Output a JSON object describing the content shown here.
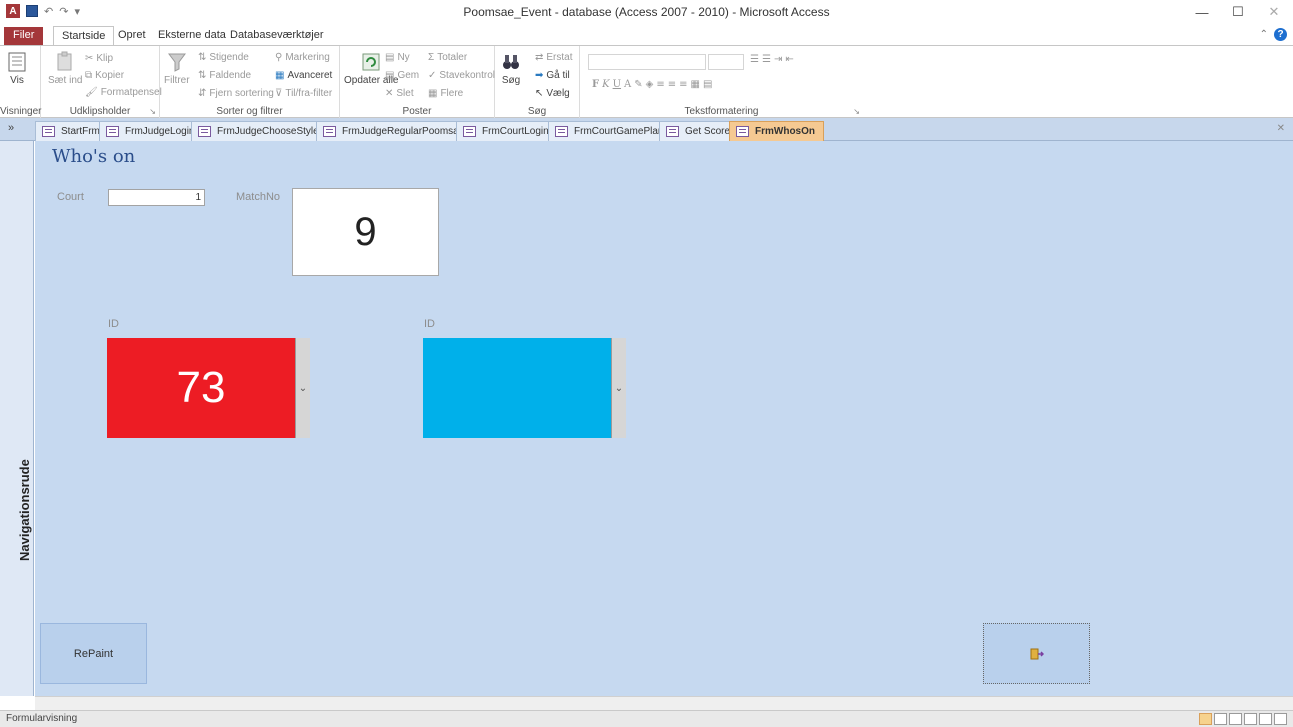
{
  "window": {
    "title": "Poomsae_Event - database (Access 2007 - 2010) - Microsoft Access",
    "app_icon_letter": "A",
    "minimize": "—",
    "maximize": "☐",
    "close": "✕",
    "help": "?",
    "collapse": "⌃"
  },
  "ribbon_tabs": [
    "Filer",
    "Startside",
    "Opret",
    "Eksterne data",
    "Databaseværktøjer"
  ],
  "ribbon": {
    "visninger": {
      "vis": "Vis",
      "name": "Visninger"
    },
    "clipboard": {
      "paste": "Sæt ind",
      "cut": "Klip",
      "copy": "Kopier",
      "format_painter": "Formatpensel",
      "name": "Udklipsholder"
    },
    "sort": {
      "filter": "Filtrer",
      "asc": "Stigende",
      "desc": "Faldende",
      "remove": "Fjern sortering",
      "selection": "Markering",
      "advanced": "Avanceret",
      "toggle": "Til/fra-filter",
      "name": "Sorter og filtrer"
    },
    "records": {
      "refresh": "Opdater alle",
      "new": "Ny",
      "save": "Gem",
      "delete": "Slet",
      "totals": "Totaler",
      "spelling": "Stavekontrol",
      "more": "Flere",
      "name": "Poster"
    },
    "find": {
      "find": "Søg",
      "replace": "Erstat",
      "goto": "Gå til",
      "select": "Vælg",
      "name": "Søg"
    },
    "text": {
      "bold": "F",
      "italic": "K",
      "underline": "U",
      "name": "Tekstformatering"
    }
  },
  "doc_tabs": [
    "StartFrm",
    "FrmJudgeLogin",
    "FrmJudgeChooseStyle",
    "FrmJudgeRegularPoomsae",
    "FrmCourtLogin",
    "FrmCourtGamePlan",
    "Get Score",
    "FrmWhosOn"
  ],
  "nav_pane_label": "Navigationsrude",
  "form": {
    "title": "Who's on",
    "court_label": "Court",
    "court_value": "1",
    "match_label": "MatchNo",
    "match_value": "9",
    "red": {
      "label": "ID",
      "value": "73",
      "color": "#ed1c24"
    },
    "blue": {
      "label": "ID",
      "value": "",
      "color": "#00b0ea"
    },
    "repaint": "RePaint"
  },
  "status": {
    "text": "Formularvisning"
  }
}
